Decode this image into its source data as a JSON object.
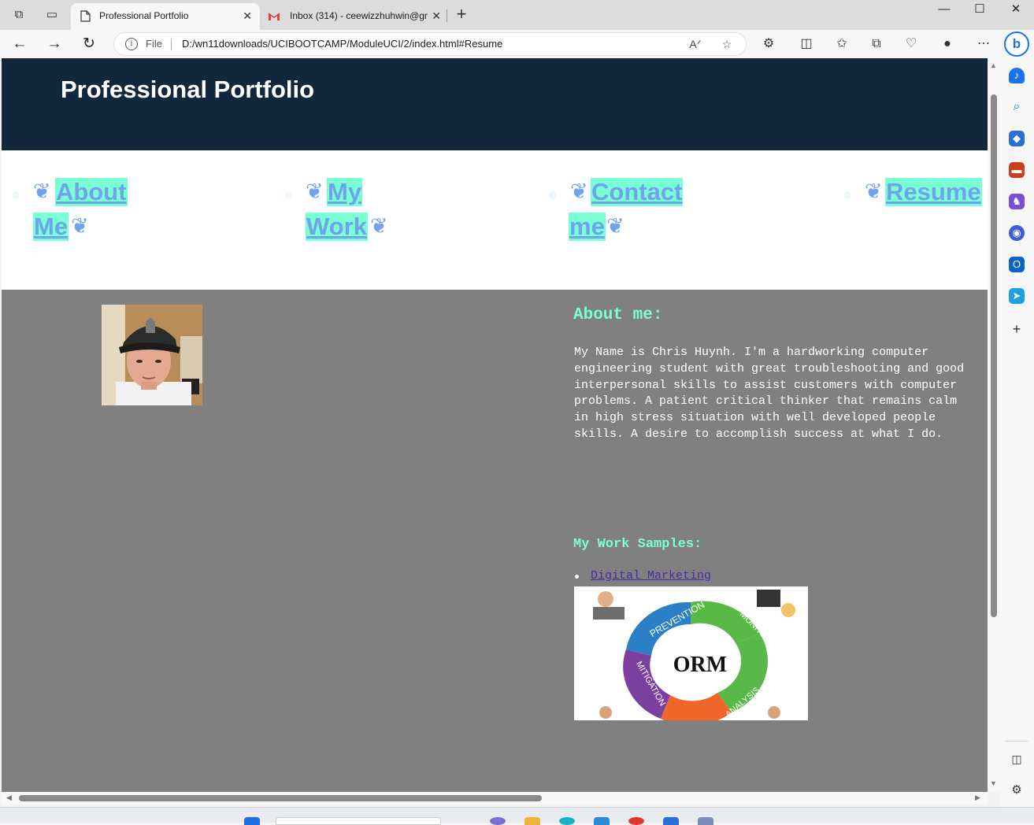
{
  "browser": {
    "tabs": [
      {
        "title": "Professional Portfolio",
        "active": true
      },
      {
        "title": "Inbox (314) - ceewizzhuhwin@gr",
        "active": false
      }
    ],
    "address": {
      "scheme_label": "File",
      "url": "D:/wn11downloads/UCIBOOTCAMP/ModuleUCI/2/index.html#Resume"
    },
    "accent_color": "#1a73e8"
  },
  "page": {
    "header": {
      "title": "Professional Portfolio",
      "bg_color": "#13273c"
    },
    "nav": {
      "items": [
        {
          "label_line1": "About",
          "label_line2": "Me"
        },
        {
          "label_line1": "My",
          "label_line2": "Work"
        },
        {
          "label_line1": "Contact",
          "label_line2": "me"
        },
        {
          "label_line1": "Resume",
          "label_line2": ""
        }
      ],
      "highlight_color": "#7affd4",
      "text_color": "#6fa3ec",
      "fleuron": "❦"
    },
    "about": {
      "heading": "About me:",
      "lines": [
        "My Name is Chris Huynh. I'm a hardworking computer",
        "engineering student with great troubleshooting and good",
        "interpersonal skills to assist customers with computer",
        "problems. A patient critical thinker that remains calm",
        "in high stress situation with well developed people",
        "skills. A desire to accomplish success at what I do."
      ]
    },
    "work": {
      "heading": "My Work Samples:",
      "samples": [
        {
          "label": "Digital Marketing"
        }
      ],
      "image_labels": {
        "center": "ORM",
        "top": "PREVENTION",
        "right": "MONITORING",
        "bottom": "ANALYSIS",
        "left": "MITIGATION"
      }
    },
    "main_bg_color": "#808080"
  }
}
